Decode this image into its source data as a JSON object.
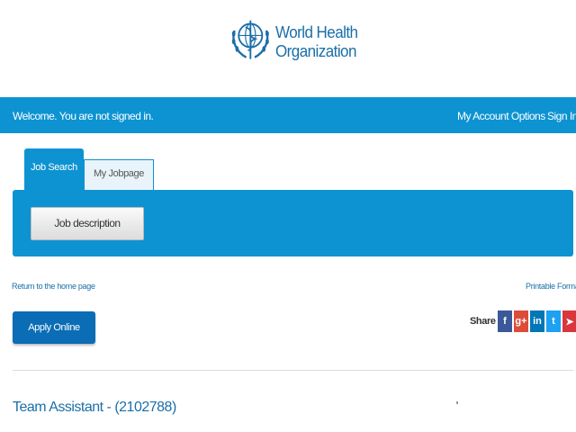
{
  "header": {
    "logo_line1": "World Health",
    "logo_line2": "Organization"
  },
  "topbar": {
    "welcome": "Welcome. You are not signed in.",
    "account_options": "My Account Options",
    "sign_in": "Sign In"
  },
  "tabs": [
    {
      "label": "Job Search",
      "active": true
    },
    {
      "label": "My Jobpage",
      "active": false
    }
  ],
  "panel": {
    "job_description_button": "Job description"
  },
  "links": {
    "return_home": "Return to the home page",
    "printable": "Printable Format"
  },
  "actions": {
    "apply_online": "Apply Online"
  },
  "share": {
    "label": "Share :",
    "icons": [
      {
        "name": "facebook-icon",
        "glyph": "f",
        "color": "#3b5998"
      },
      {
        "name": "google-plus-icon",
        "glyph": "g+",
        "color": "#dd4b39"
      },
      {
        "name": "linkedin-icon",
        "glyph": "in",
        "color": "#0077b5"
      },
      {
        "name": "twitter-icon",
        "glyph": "t",
        "color": "#1da1f2"
      },
      {
        "name": "send-icon",
        "glyph": "➤",
        "color": "#d9363e"
      }
    ]
  },
  "job": {
    "title": "Team Assistant - (2102788)"
  },
  "colors": {
    "brand_blue": "#0d93d2",
    "link_blue": "#1a6fa8"
  }
}
